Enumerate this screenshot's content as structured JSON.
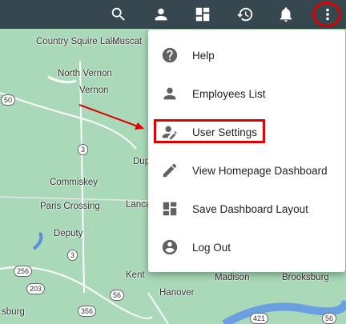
{
  "colors": {
    "topbar": "#37474f",
    "highlight": "#e00000",
    "menu_icon": "#616161",
    "map_green": "#a9d9b8"
  },
  "topbar": {
    "icons": [
      "search-icon",
      "account-icon",
      "dashboard-icon",
      "history-icon",
      "notifications-icon",
      "more-vert-icon"
    ]
  },
  "menu": {
    "items": [
      {
        "label": "Help",
        "icon": "help-icon"
      },
      {
        "label": "Employees List",
        "icon": "person-icon"
      },
      {
        "label": "User Settings",
        "icon": "person-edit-icon"
      },
      {
        "label": "View Homepage Dashboard",
        "icon": "pencil-icon"
      },
      {
        "label": "Save Dashboard Layout",
        "icon": "dashboard-icon"
      },
      {
        "label": "Log Out",
        "icon": "account-circle-icon"
      }
    ]
  },
  "map": {
    "places": [
      "Country Squire Lakes",
      "Muscat",
      "North Vernon",
      "Vernon",
      "Dup",
      "Commiskey",
      "Paris Crossing",
      "Lanca",
      "Deputy",
      "Kent",
      "Hanover",
      "Madison",
      "Brooksburg",
      "sburg"
    ],
    "route_shields": [
      "50",
      "3",
      "256",
      "203",
      "3",
      "56",
      "356",
      "421",
      "56"
    ]
  }
}
